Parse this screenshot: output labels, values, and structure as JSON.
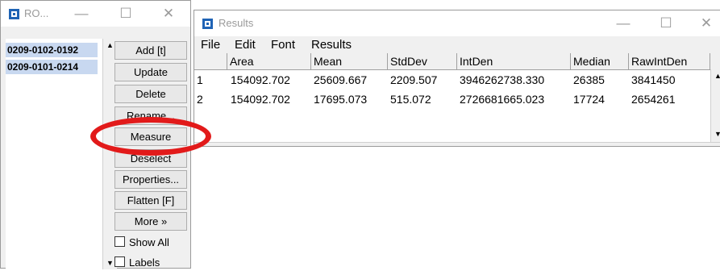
{
  "roi_window": {
    "title": "RO...",
    "items": [
      "0209-0102-0192",
      "0209-0101-0214"
    ],
    "buttons": [
      "Add [t]",
      "Update",
      "Delete",
      "Rename...",
      "Measure",
      "Deselect",
      "Properties...",
      "Flatten [F]",
      "More »"
    ],
    "checkboxes": [
      "Show All",
      "Labels"
    ]
  },
  "results_window": {
    "title": "Results",
    "menus": [
      "File",
      "Edit",
      "Font",
      "Results"
    ],
    "columns": [
      "Area",
      "Mean",
      "StdDev",
      "IntDen",
      "Median",
      "RawIntDen"
    ],
    "rows": [
      {
        "n": "1",
        "cells": [
          "154092.702",
          "25609.667",
          "2209.507",
          "3946262738.330",
          "26385",
          "3841450"
        ]
      },
      {
        "n": "2",
        "cells": [
          "154092.702",
          "17695.073",
          "515.072",
          "2726681665.023",
          "17724",
          "2654261"
        ]
      }
    ]
  },
  "controls": {
    "minimize": "—",
    "maximize": "☐",
    "close": "✕"
  },
  "highlight": {
    "target": "Measure",
    "color": "#e21a1a"
  }
}
